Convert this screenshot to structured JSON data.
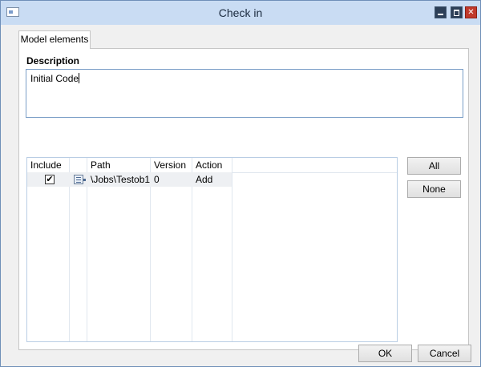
{
  "window": {
    "title": "Check in",
    "minimize_icon": "minimize-icon",
    "maximize_icon": "maximize-icon",
    "close_icon": "close-icon"
  },
  "tabs": [
    {
      "label": "Model elements",
      "selected": true
    }
  ],
  "description": {
    "label": "Description",
    "value": "Initial Code"
  },
  "grid": {
    "columns": [
      "Include",
      "",
      "Path",
      "Version",
      "Action"
    ],
    "rows": [
      {
        "include": true,
        "icon": "object-icon",
        "path": "\\Jobs\\Testob1",
        "version": "0",
        "action": "Add"
      }
    ]
  },
  "buttons": {
    "all": "All",
    "none": "None",
    "ok": "OK",
    "cancel": "Cancel"
  },
  "colors": {
    "titlebar": "#c9dcf3",
    "accent_border": "#7a9ec7",
    "close_button": "#c0392b"
  }
}
